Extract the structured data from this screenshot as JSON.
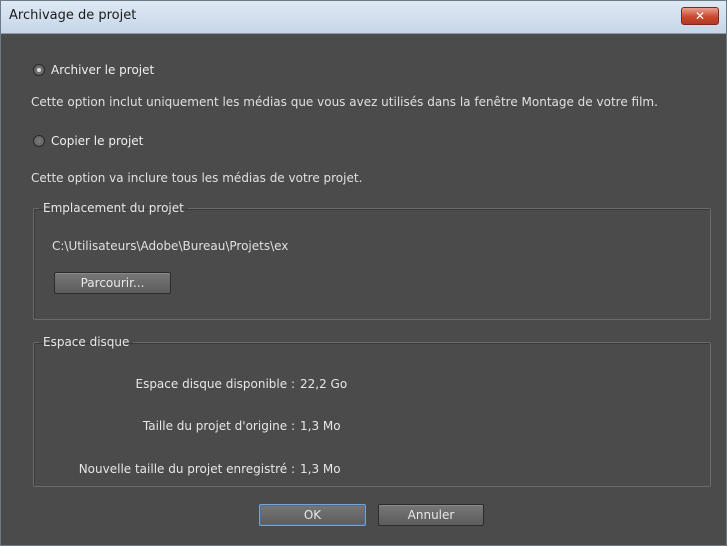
{
  "window": {
    "title": "Archivage de projet",
    "close_glyph": "✕"
  },
  "options": {
    "archive": {
      "label": "Archiver le projet",
      "checked": true,
      "description": "Cette option inclut uniquement les médias que vous avez utilisés dans la fenêtre Montage de votre film."
    },
    "copy": {
      "label": "Copier le projet",
      "checked": false,
      "description": "Cette option va inclure tous les médias de votre projet."
    }
  },
  "location": {
    "legend": "Emplacement du projet",
    "path": "C:\\Utilisateurs\\Adobe\\Bureau\\Projets\\ex",
    "browse_label": "Parcourir..."
  },
  "disk": {
    "legend": "Espace disque",
    "rows": [
      {
        "label": "Espace disque disponible :",
        "value": "22,2 Go"
      },
      {
        "label": "Taille du projet d'origine :",
        "value": "1,3 Mo"
      },
      {
        "label": "Nouvelle taille du projet enregistré :",
        "value": "1,3 Mo"
      }
    ]
  },
  "buttons": {
    "ok": "OK",
    "cancel": "Annuler"
  },
  "colors": {
    "dialog_bg": "#4b4b4b",
    "titlebar": "#d3dfed",
    "close_red": "#c8492f"
  }
}
